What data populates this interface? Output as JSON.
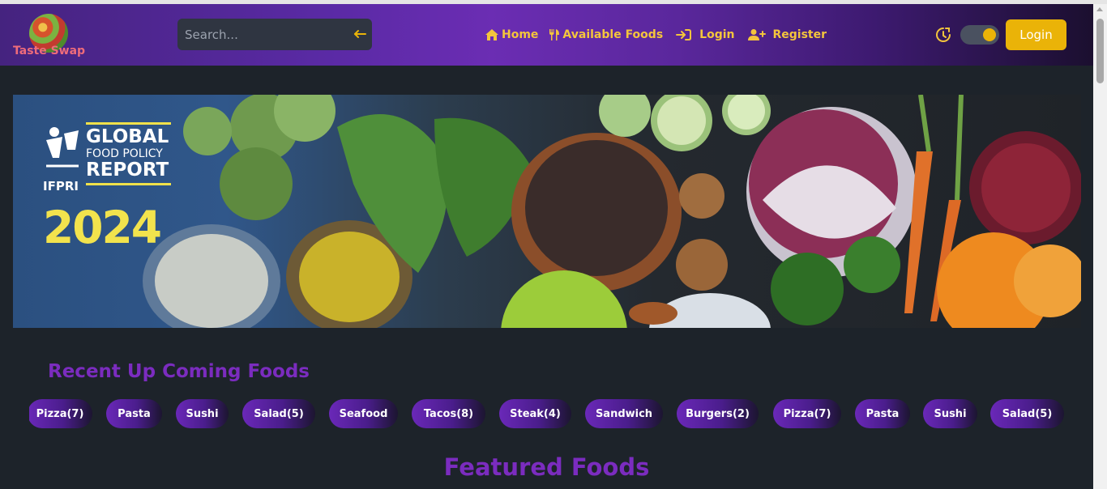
{
  "brand": {
    "name": "Taste Swap"
  },
  "search": {
    "placeholder": "Search..."
  },
  "nav": {
    "links": [
      {
        "label": "Home",
        "icon": "home-icon"
      },
      {
        "label": "Available Foods",
        "icon": "utensils-icon"
      },
      {
        "label": "Login",
        "icon": "sign-in-icon"
      },
      {
        "label": "Register",
        "icon": "user-plus-icon"
      }
    ],
    "login_button": "Login"
  },
  "theme": {
    "toggle_on": true,
    "accent": "#eab308"
  },
  "banner": {
    "org": "IFPRI",
    "title_line1": "GLOBAL",
    "title_line2": "FOOD POLICY",
    "title_line3": "REPORT",
    "year": "2024"
  },
  "recent": {
    "title": "Recent Up Coming Foods",
    "chips": [
      "Pizza(7)",
      "Pasta",
      "Sushi",
      "Salad(5)",
      "Seafood",
      "Tacos(8)",
      "Steak(4)",
      "Sandwich",
      "Burgers(2)",
      "Pizza(7)",
      "Pasta",
      "Sushi",
      "Salad(5)"
    ]
  },
  "featured": {
    "title": "Featured Foods"
  },
  "colors": {
    "primary": "#7b2cbf",
    "nav_text": "#f4c53c",
    "background": "#1d232a"
  }
}
